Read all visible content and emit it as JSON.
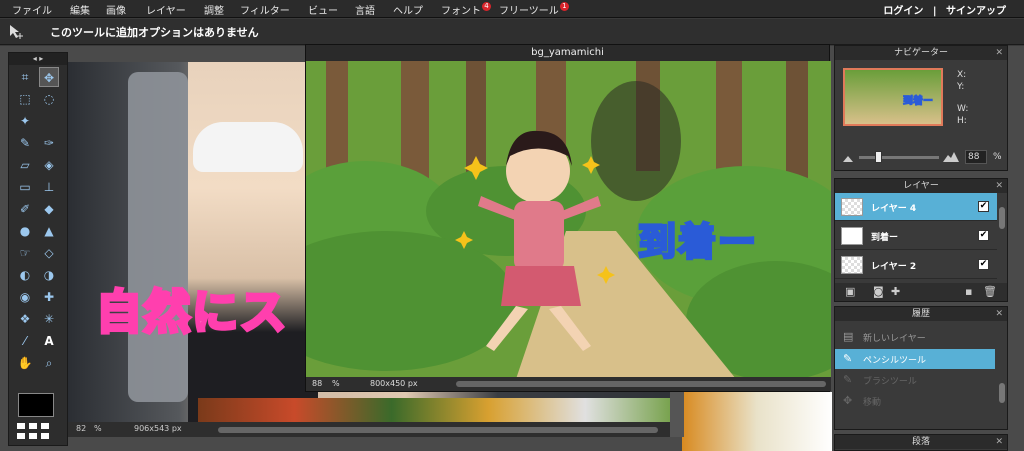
{
  "menubar": {
    "items": [
      "ファイル",
      "編集",
      "画像",
      "レイヤー",
      "調整",
      "フィルター",
      "ビュー",
      "言語",
      "ヘルプ",
      "フォント",
      "フリーツール"
    ],
    "font_badge": "4",
    "freetool_badge": "1",
    "login": "ログイン",
    "separator": "|",
    "signup": "サインアップ"
  },
  "options_bar": {
    "message": "このツールに追加オプションはありません"
  },
  "toolbox": {
    "nav_arrows": "◂ ▸",
    "icons": [
      "crop-icon",
      "move-icon",
      "marquee-icon",
      "lasso-icon",
      "magic-wand-icon",
      "",
      "pencil-icon",
      "brush-icon",
      "eraser-icon",
      "fill-bucket-icon",
      "gradient-icon",
      "stamp-icon",
      "color-replace-icon",
      "drawing-icon",
      "blur-icon",
      "sharpen-icon",
      "smudge-icon",
      "sponge-icon",
      "dodge-icon",
      "burn-icon",
      "red-eye-icon",
      "spot-heal-icon",
      "bloat-icon",
      "pinch-icon",
      "color-picker-icon",
      "type-icon",
      "hand-icon",
      "zoom-icon"
    ],
    "foreground_color": "#000000"
  },
  "doc_back": {
    "overlay_text": "自然にス",
    "zoom": "82",
    "zoom_unit": "%",
    "size": "906x543 px"
  },
  "doc_front": {
    "title": "bg_yamamichi",
    "overlay_text": "到着ー",
    "zoom": "88",
    "zoom_unit": "%",
    "size": "800x450 px"
  },
  "navigator": {
    "title": "ナビゲーター",
    "x_label": "X:",
    "y_label": "Y:",
    "w_label": "W:",
    "h_label": "H:",
    "thumb_text": "到着ー",
    "zoom": "88",
    "zoom_unit": "%",
    "zoom_fraction": 0.25
  },
  "layers": {
    "title": "レイヤー",
    "items": [
      {
        "name": "レイヤー 4",
        "checked": "✔"
      },
      {
        "name": "到着ー",
        "checked": "✔"
      },
      {
        "name": "レイヤー 2",
        "checked": "✔"
      }
    ]
  },
  "history": {
    "title": "履歴",
    "items": [
      "新しいレイヤー",
      "ペンシルツール",
      "ブラシツール",
      "移動"
    ]
  },
  "bottom_panel": {
    "title": "段落"
  },
  "colors": {
    "accent": "#58b0d6",
    "overlay_pink": "#ff3fae",
    "overlay_blue": "#2a5bd7"
  }
}
